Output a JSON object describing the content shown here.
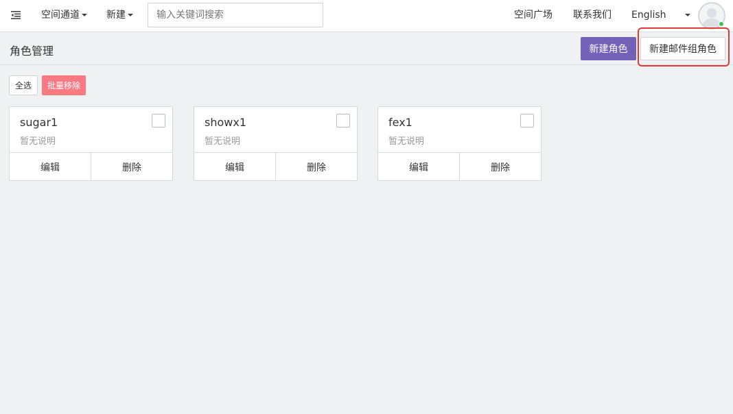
{
  "header": {
    "nav": [
      {
        "label": "空间通道"
      },
      {
        "label": "新建"
      }
    ],
    "search": {
      "placeholder": "输入关键词搜索",
      "value": ""
    },
    "right_links": [
      {
        "label": "空间广场"
      },
      {
        "label": "联系我们"
      },
      {
        "label": "English"
      }
    ],
    "menu_icon": "menu-collapse-icon",
    "avatar_icon": "user-avatar-icon",
    "status_color": "#3ec15b"
  },
  "page": {
    "title": "角色管理",
    "new_role_label": "新建角色",
    "new_mail_group_role_label": "新建邮件组角色",
    "accent_color": "#7262b8",
    "highlight_color": "#e03a34"
  },
  "toolbar": {
    "select_all_label": "全选",
    "batch_remove_label": "批量移除",
    "danger_color": "#f97a83"
  },
  "roles": [
    {
      "name": "sugar1",
      "description": "暂无说明",
      "edit_label": "编辑",
      "delete_label": "删除"
    },
    {
      "name": "showx1",
      "description": "暂无说明",
      "edit_label": "编辑",
      "delete_label": "删除"
    },
    {
      "name": "fex1",
      "description": "暂无说明",
      "edit_label": "编辑",
      "delete_label": "删除"
    }
  ]
}
